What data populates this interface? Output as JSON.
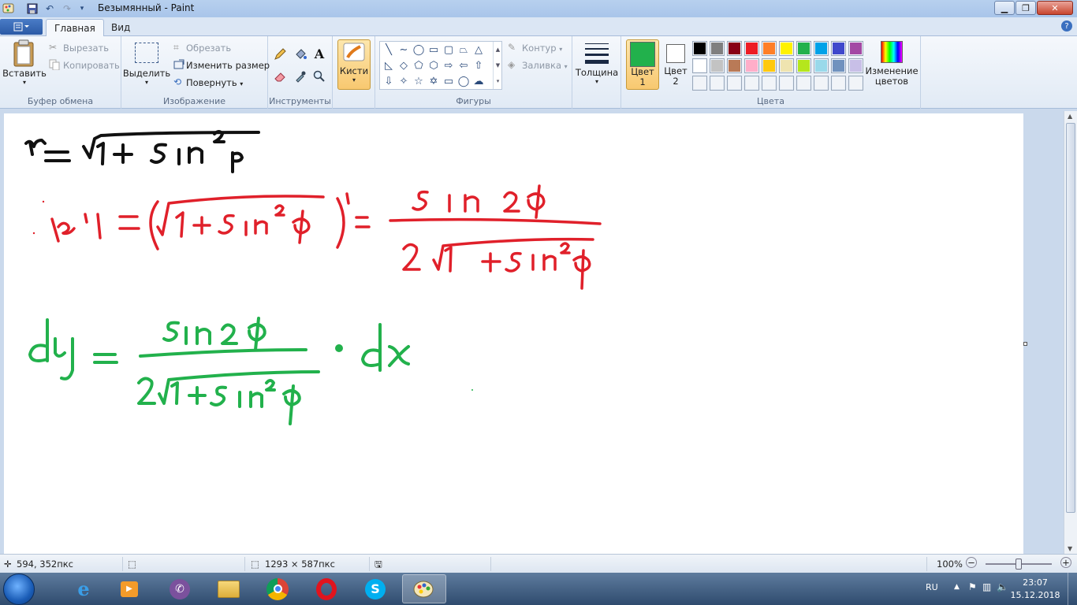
{
  "window": {
    "title": "Безымянный - Paint"
  },
  "tabs": {
    "file": "",
    "home": "Главная",
    "view": "Вид"
  },
  "clipboard": {
    "paste": "Вставить",
    "cut": "Вырезать",
    "copy": "Копировать",
    "group": "Буфер обмена"
  },
  "image": {
    "select": "Выделить",
    "crop": "Обрезать",
    "resize": "Изменить размер",
    "rotate": "Повернуть",
    "group": "Изображение"
  },
  "tools": {
    "group": "Инструменты"
  },
  "brushes": {
    "label": "Кисти"
  },
  "shapes": {
    "outline": "Контур",
    "fill": "Заливка",
    "group": "Фигуры"
  },
  "size": {
    "label": "Толщина"
  },
  "colors": {
    "color1_a": "Цвет",
    "color1_b": "1",
    "color2_a": "Цвет",
    "color2_b": "2",
    "edit_a": "Изменение",
    "edit_b": "цветов",
    "group": "Цвета",
    "color1_value": "#22b14c",
    "color2_value": "#ffffff",
    "palette_row1": [
      "#000000",
      "#7f7f7f",
      "#880015",
      "#ed1c24",
      "#ff7f27",
      "#fff200",
      "#22b14c",
      "#00a2e8",
      "#3f48cc",
      "#a349a4"
    ],
    "palette_row2": [
      "#ffffff",
      "#c3c3c3",
      "#b97a57",
      "#ffaec9",
      "#ffc90e",
      "#efe4b0",
      "#b5e61d",
      "#99d9ea",
      "#7092be",
      "#c8bfe7"
    ]
  },
  "status": {
    "cursor": "594, 352пкс",
    "canvas_size": "1293 × 587пкс",
    "zoom": "100%"
  },
  "tray": {
    "lang": "RU",
    "time": "23:07",
    "date": "15.12.2018"
  }
}
